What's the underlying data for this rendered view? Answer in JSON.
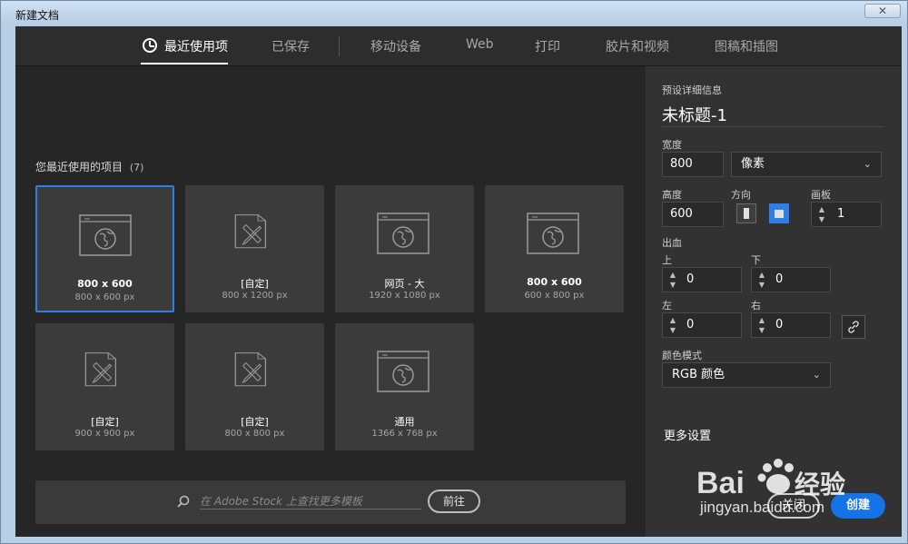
{
  "window": {
    "title": "新建文档",
    "close_glyph": "✕"
  },
  "tabs": [
    {
      "label": "最近使用项",
      "active": true
    },
    {
      "label": "已保存"
    },
    {
      "label": "移动设备"
    },
    {
      "label": "Web"
    },
    {
      "label": "打印"
    },
    {
      "label": "胶片和视频"
    },
    {
      "label": "图稿和插图"
    }
  ],
  "recent": {
    "heading": "您最近使用的项目",
    "count": "(7)",
    "cards": [
      {
        "name": "800 x 600",
        "size": "800 x 600 px",
        "icon": "web-globe-icon",
        "selected": true
      },
      {
        "name": "[自定]",
        "size": "800 x 1200 px",
        "icon": "pencil-ruler-doc-icon"
      },
      {
        "name": "网页 - 大",
        "size": "1920 x 1080 px",
        "icon": "web-globe-icon"
      },
      {
        "name": "800 x 600",
        "size": "600 x 800 px",
        "icon": "web-globe-icon"
      },
      {
        "name": "[自定]",
        "size": "900 x 900 px",
        "icon": "pencil-ruler-doc-icon"
      },
      {
        "name": "[自定]",
        "size": "800 x 800 px",
        "icon": "pencil-ruler-doc-icon"
      },
      {
        "name": "通用",
        "size": "1366 x 768 px",
        "icon": "web-globe-icon"
      }
    ]
  },
  "search": {
    "placeholder": "在 Adobe Stock 上查找更多模板",
    "go_label": "前往"
  },
  "preset": {
    "section_label": "预设详细信息",
    "doc_title": "未标题-1",
    "width_label": "宽度",
    "width_value": "800",
    "unit_value": "像素",
    "height_label": "高度",
    "height_value": "600",
    "orientation_label": "方向",
    "artboards_label": "画板",
    "artboards_value": "1",
    "bleed_label": "出血",
    "top_label": "上",
    "top_value": "0",
    "bottom_label": "下",
    "bottom_value": "0",
    "left_label": "左",
    "left_value": "0",
    "right_label": "右",
    "right_value": "0",
    "color_mode_label": "颜色模式",
    "color_mode_value": "RGB 颜色",
    "more_settings": "更多设置",
    "close_label": "关闭",
    "create_label": "创建"
  },
  "watermark": {
    "brand": "Bai",
    "brand2": "经验",
    "url": "jingyan.baidu.com"
  },
  "colors": {
    "accent": "#1473e6",
    "selected_border": "#2f7ee8"
  }
}
